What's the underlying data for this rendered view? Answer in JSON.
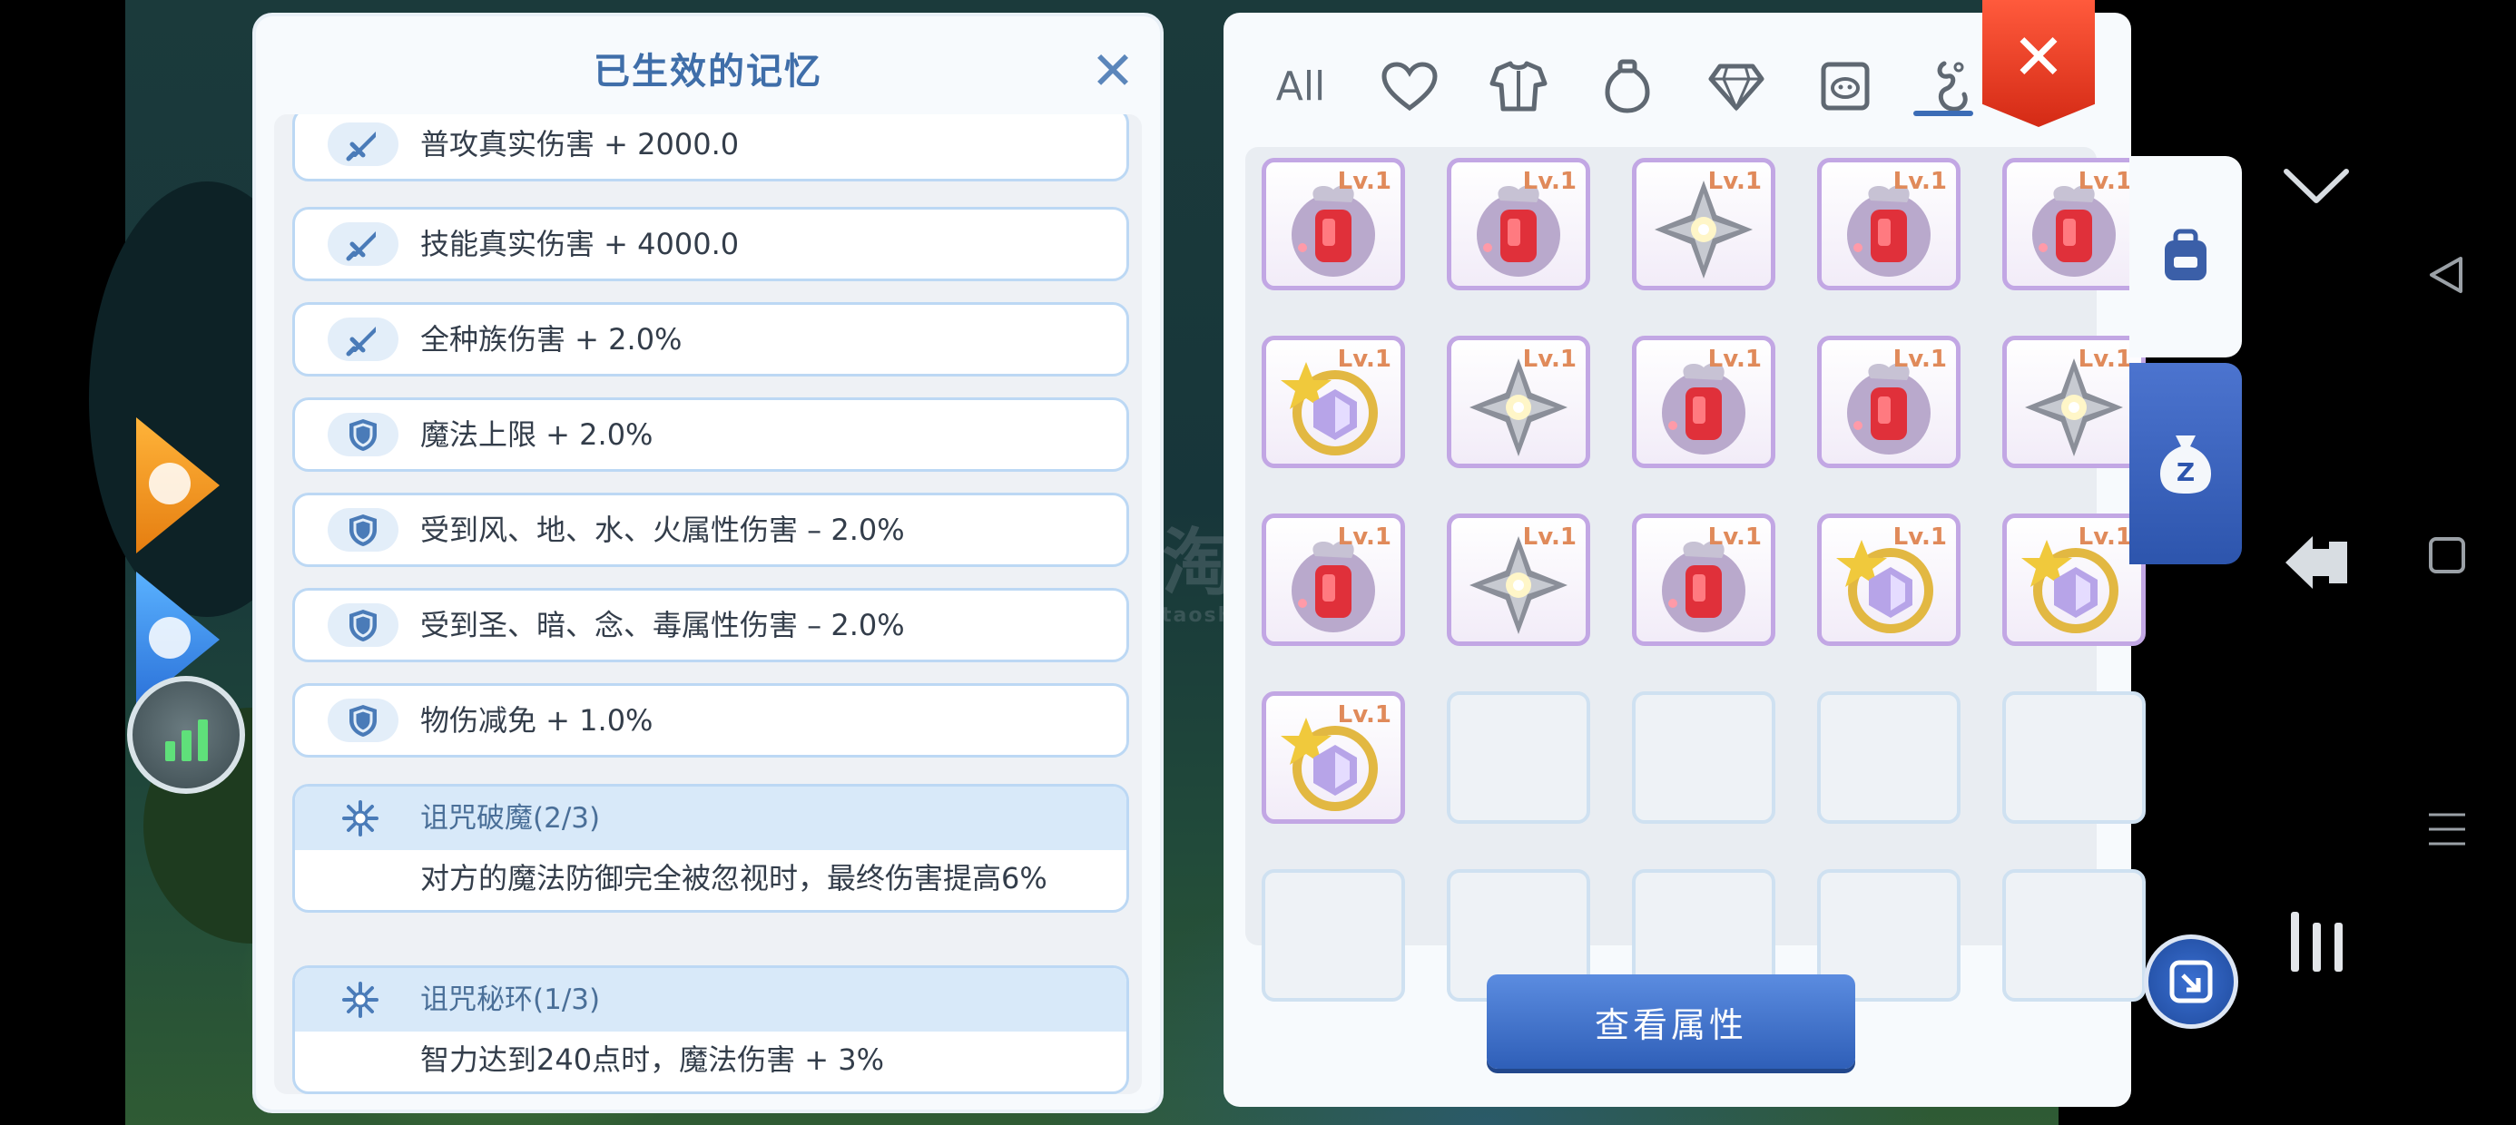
{
  "memory_panel": {
    "title": "已生效的记忆",
    "close_icon": "close-x-icon",
    "items": [
      {
        "icon": "sword-icon",
        "text": "普攻真实伤害 + 2000.0"
      },
      {
        "icon": "sword-icon",
        "text": "技能真实伤害 + 4000.0"
      },
      {
        "icon": "sword-icon",
        "text": "全种族伤害 + 2.0%"
      },
      {
        "icon": "shield-icon",
        "text": "魔法上限 + 2.0%"
      },
      {
        "icon": "shield-icon",
        "text": "受到风、地、水、火属性伤害 – 2.0%"
      },
      {
        "icon": "shield-icon",
        "text": "受到圣、暗、念、毒属性伤害 – 2.0%"
      },
      {
        "icon": "shield-icon",
        "text": "物伤减免 + 1.0%"
      }
    ],
    "sets": [
      {
        "icon": "sparkle-icon",
        "name": "诅咒破魔(2/3)",
        "desc": "对方的魔法防御完全被忽视时，最终伤害提高6%"
      },
      {
        "icon": "sparkle-icon",
        "name": "诅咒秘环(1/3)",
        "desc": "智力达到240点时，魔法伤害 + 3%"
      }
    ]
  },
  "bag_panel": {
    "tabs": [
      {
        "label": "All",
        "icon": "all-text"
      },
      {
        "label": "",
        "icon": "heart-icon"
      },
      {
        "label": "",
        "icon": "armor-icon"
      },
      {
        "label": "",
        "icon": "potion-icon"
      },
      {
        "label": "",
        "icon": "gem-icon"
      },
      {
        "label": "",
        "icon": "card-icon"
      },
      {
        "label": "",
        "icon": "memory-icon"
      }
    ],
    "active_tab": 6,
    "close_icon": "close-x-icon",
    "slots": [
      {
        "item": "red-potion",
        "level": "Lv.1"
      },
      {
        "item": "red-potion",
        "level": "Lv.1"
      },
      {
        "item": "silver-crystal",
        "level": "Lv.1"
      },
      {
        "item": "red-potion",
        "level": "Lv.1"
      },
      {
        "item": "red-potion",
        "level": "Lv.1"
      },
      {
        "item": "gold-crystal",
        "level": "Lv.1"
      },
      {
        "item": "silver-crystal",
        "level": "Lv.1"
      },
      {
        "item": "red-potion",
        "level": "Lv.1"
      },
      {
        "item": "red-potion",
        "level": "Lv.1"
      },
      {
        "item": "silver-crystal",
        "level": "Lv.1"
      },
      {
        "item": "red-potion",
        "level": "Lv.1"
      },
      {
        "item": "silver-crystal",
        "level": "Lv.1"
      },
      {
        "item": "red-potion",
        "level": "Lv.1"
      },
      {
        "item": "gold-crystal",
        "level": "Lv.1"
      },
      {
        "item": "gold-crystal",
        "level": "Lv.1"
      },
      {
        "item": "gold-crystal",
        "level": "Lv.1"
      },
      {
        "item": null,
        "level": ""
      },
      {
        "item": null,
        "level": ""
      },
      {
        "item": null,
        "level": ""
      },
      {
        "item": null,
        "level": ""
      },
      {
        "item": null,
        "level": ""
      },
      {
        "item": null,
        "level": ""
      },
      {
        "item": null,
        "level": ""
      },
      {
        "item": null,
        "level": ""
      },
      {
        "item": null,
        "level": ""
      }
    ],
    "view_button": "查看属性"
  },
  "side_tabs": [
    {
      "icon": "backpack-icon"
    },
    {
      "icon": "zeny-bag-icon"
    }
  ],
  "system_nav": [
    "chevron-down-icon",
    "back-triangle-icon",
    "home-square-icon",
    "menu-lines-icon"
  ],
  "colors": {
    "accent": "#3b6cb6",
    "close_red": "#e0391f",
    "slot_border": "#c2a7e4",
    "lv_text": "#e08a5a"
  }
}
